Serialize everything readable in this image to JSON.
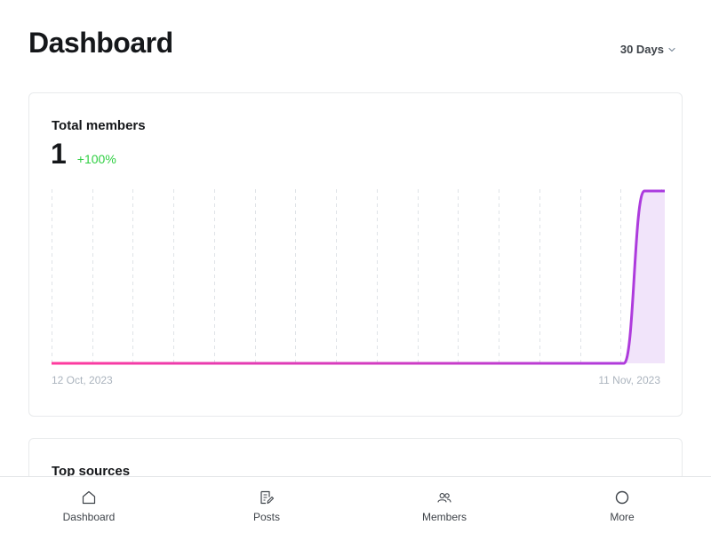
{
  "header": {
    "title": "Dashboard",
    "range_label": "30 Days"
  },
  "members_card": {
    "title": "Total members",
    "value": "1",
    "change": "+100%",
    "axis_start": "12 Oct, 2023",
    "axis_end": "11 Nov, 2023"
  },
  "sources_card": {
    "title": "Top sources"
  },
  "nav": {
    "items": [
      {
        "label": "Dashboard",
        "icon": "home-icon"
      },
      {
        "label": "Posts",
        "icon": "posts-icon"
      },
      {
        "label": "Members",
        "icon": "members-icon"
      },
      {
        "label": "More",
        "icon": "circle-icon"
      }
    ]
  },
  "colors": {
    "positive": "#30cf43",
    "line_start": "#ff3b9d",
    "line_end": "#a93be0",
    "area_fill": "#f1e4fa",
    "grid": "#dfe3e7"
  },
  "chart_data": {
    "type": "area",
    "title": "Total members",
    "x_start": "2023-10-12",
    "x_end": "2023-11-11",
    "x": [
      "2023-10-12",
      "2023-10-13",
      "2023-10-14",
      "2023-10-15",
      "2023-10-16",
      "2023-10-17",
      "2023-10-18",
      "2023-10-19",
      "2023-10-20",
      "2023-10-21",
      "2023-10-22",
      "2023-10-23",
      "2023-10-24",
      "2023-10-25",
      "2023-10-26",
      "2023-10-27",
      "2023-10-28",
      "2023-10-29",
      "2023-10-30",
      "2023-10-31",
      "2023-11-01",
      "2023-11-02",
      "2023-11-03",
      "2023-11-04",
      "2023-11-05",
      "2023-11-06",
      "2023-11-07",
      "2023-11-08",
      "2023-11-09",
      "2023-11-10",
      "2023-11-11"
    ],
    "values": [
      0,
      0,
      0,
      0,
      0,
      0,
      0,
      0,
      0,
      0,
      0,
      0,
      0,
      0,
      0,
      0,
      0,
      0,
      0,
      0,
      0,
      0,
      0,
      0,
      0,
      0,
      0,
      0,
      0,
      1,
      1
    ],
    "ylim": [
      0,
      1
    ],
    "grid": "vertical dashed",
    "xlabel": "",
    "ylabel": ""
  }
}
